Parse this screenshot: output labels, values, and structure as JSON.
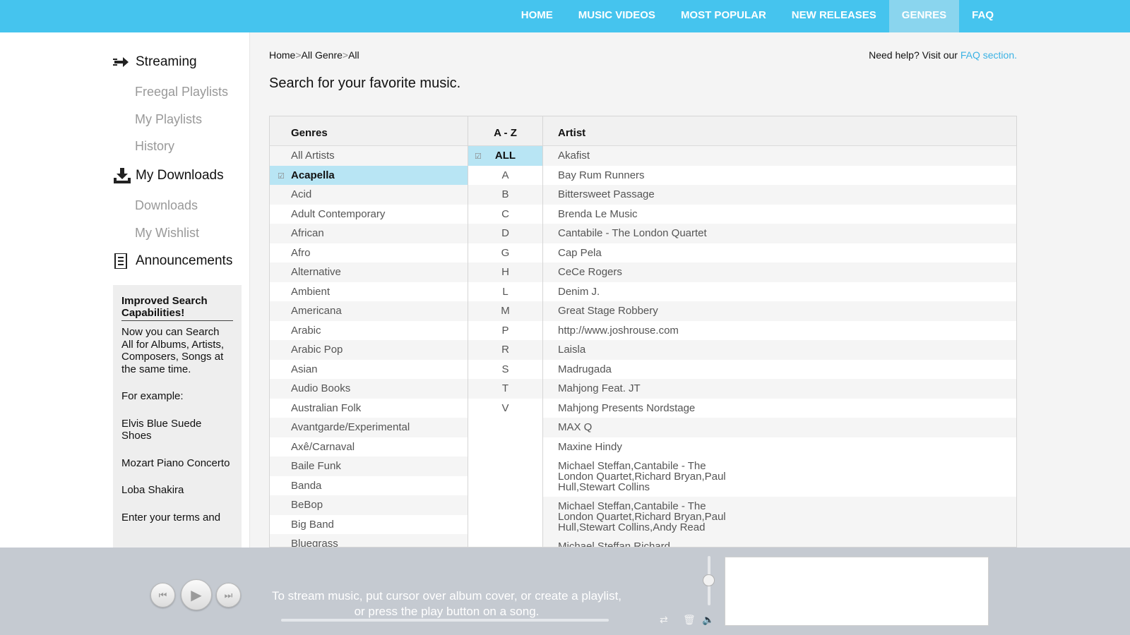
{
  "nav": {
    "items": [
      {
        "label": "HOME"
      },
      {
        "label": "MUSIC VIDEOS"
      },
      {
        "label": "MOST POPULAR"
      },
      {
        "label": "NEW RELEASES"
      },
      {
        "label": "GENRES",
        "active": true
      },
      {
        "label": "FAQ"
      }
    ]
  },
  "sidebar": {
    "streaming": {
      "label": "Streaming",
      "icon": "streaming-icon",
      "items": [
        "Freegal Playlists",
        "My Playlists",
        "History"
      ]
    },
    "downloads": {
      "label": "My Downloads",
      "icon": "download-icon",
      "items": [
        "Downloads",
        "My Wishlist"
      ]
    },
    "announcements": {
      "label": "Announcements",
      "icon": "document-icon"
    },
    "info": {
      "title": "Improved Search Capabilities!",
      "paragraphs": [
        "Now you can Search All for Albums, Artists, Composers, Songs at the same time.",
        "For example:",
        "Elvis Blue Suede Shoes",
        "Mozart Piano Concerto",
        "Loba Shakira",
        "Enter your terms and"
      ]
    }
  },
  "breadcrumb": {
    "home": "Home",
    "sep1": ">",
    "genre": "All Genre",
    "sep2": ">",
    "current": "All"
  },
  "help": {
    "text": "Need help? Visit our ",
    "link": "FAQ section."
  },
  "page_title": "Search for your favorite music.",
  "table": {
    "headers": {
      "genres": "Genres",
      "az": "A - Z",
      "artist": "Artist"
    },
    "genres": [
      "All Artists",
      "Acapella",
      "Acid",
      "Adult Contemporary",
      "African",
      "Afro",
      "Alternative",
      "Ambient",
      "Americana",
      "Arabic",
      "Arabic Pop",
      "Asian",
      "Audio Books",
      "Australian Folk",
      "Avantgarde/Experimental",
      "Axê/Carnaval",
      "Baile Funk",
      "Banda",
      "BeBop",
      "Big Band",
      "Bluegrass"
    ],
    "selected_genre": "Acapella",
    "letters": [
      "ALL",
      "A",
      "B",
      "C",
      "D",
      "G",
      "H",
      "L",
      "M",
      "P",
      "R",
      "S",
      "T",
      "V"
    ],
    "selected_letter": "ALL",
    "artists": [
      "Akafist",
      "Bay Rum Runners",
      "Bittersweet Passage",
      "Brenda Le Music",
      "Cantabile - The London Quartet",
      "Cap Pela",
      "CeCe Rogers",
      "Denim J.",
      "Great Stage Robbery",
      "http://www.joshrouse.com",
      "Laisla",
      "Madrugada",
      "Mahjong Feat. JT",
      "Mahjong Presents Nordstage",
      "MAX Q",
      "Maxine Hindy",
      "Michael Steffan,Cantabile - The London Quartet,Richard Bryan,Paul Hull,Stewart Collins",
      "Michael Steffan,Cantabile - The London Quartet,Richard Bryan,Paul Hull,Stewart Collins,Andy Read",
      "Michael Steffan,Richard"
    ]
  },
  "player": {
    "message_line1": "To stream music, put cursor over album cover, or create a playlist,",
    "message_line2": "or press the play button on a song.",
    "prev_icon": "⏮",
    "play_icon": "▶",
    "next_icon": "⏭",
    "shuffle_icon": "⇄",
    "trash_icon": "🗑",
    "speaker_icon": "🔈"
  }
}
